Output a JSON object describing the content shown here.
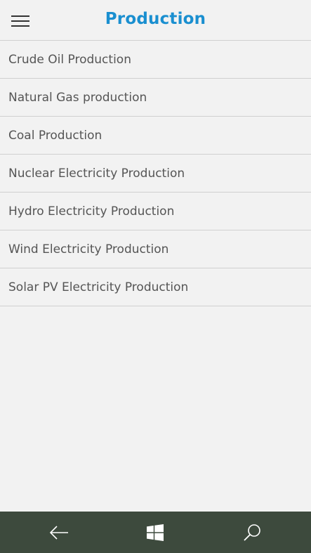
{
  "header": {
    "title": "Production",
    "menu_icon": "hamburger-icon",
    "title_color": "#1a8fd0"
  },
  "list": {
    "items": [
      {
        "label": "Crude Oil Production"
      },
      {
        "label": "Natural Gas production"
      },
      {
        "label": "Coal Production"
      },
      {
        "label": "Nuclear Electricity Production"
      },
      {
        "label": "Hydro Electricity Production"
      },
      {
        "label": "Wind Electricity Production"
      },
      {
        "label": "Solar PV Electricity Production"
      }
    ]
  },
  "nav_bar": {
    "background": "#3d4a3d",
    "icons": [
      "back-arrow-icon",
      "windows-logo-icon",
      "search-icon"
    ]
  }
}
